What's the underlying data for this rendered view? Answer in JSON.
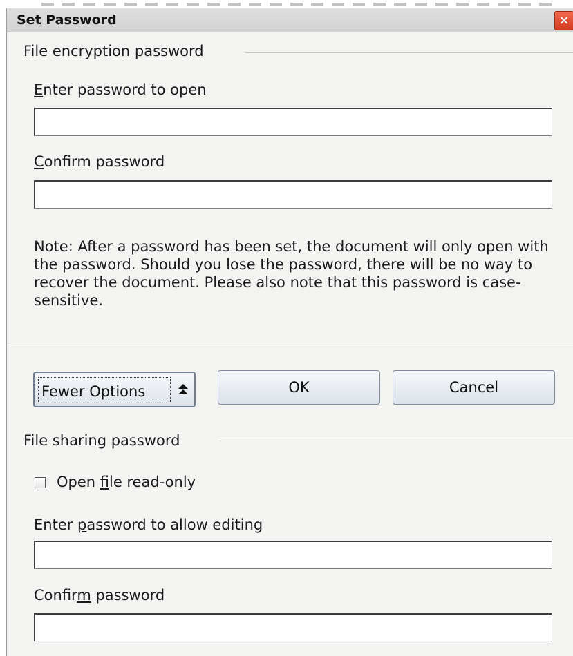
{
  "window": {
    "title": "Set Password",
    "close_glyph": "×"
  },
  "encryption": {
    "section_title": "File encryption password",
    "open_label_accesskey": "E",
    "open_label_rest": "nter password to open",
    "open_value": "",
    "confirm_label_accesskey": "C",
    "confirm_label_rest": "onfirm password",
    "confirm_value": "",
    "note": "Note: After a password has been set, the document will only open with the password. Should you lose the password, there will be no way to recover the document. Please also note that this password is case-sensitive."
  },
  "buttons": {
    "fewer_options": "Fewer Options",
    "fewer_options_icon": "double-chevron-up-icon",
    "ok": "OK",
    "cancel": "Cancel"
  },
  "sharing": {
    "section_title": "File sharing password",
    "readonly_pre": "Open ",
    "readonly_accesskey": "f",
    "readonly_post": "ile read-only",
    "readonly_checked": false,
    "edit_label_pre": "Enter ",
    "edit_label_accesskey": "p",
    "edit_label_post": "assword to allow editing",
    "edit_value": "",
    "confirm_pre": "Confir",
    "confirm_accesskey": "m",
    "confirm_post": " password",
    "confirm_value": ""
  }
}
